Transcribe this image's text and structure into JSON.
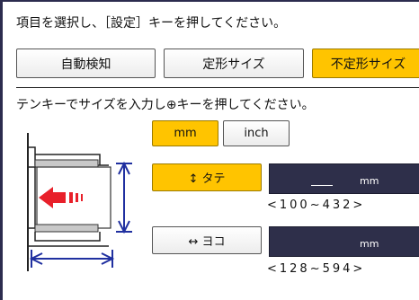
{
  "instruction": "項目を選択し、［設定］キーを押してください。",
  "tabs": [
    {
      "label": "自動検知",
      "active": false
    },
    {
      "label": "定形サイズ",
      "active": false
    },
    {
      "label": "不定形サイズ",
      "active": true
    }
  ],
  "instruction2": "テンキーでサイズを入力し⊕キーを押してください。",
  "units": {
    "mm_label": "mm",
    "inch_label": "inch",
    "selected": "mm"
  },
  "vertical": {
    "label": "↕ タテ",
    "value": "",
    "unit": "mm",
    "range": "<100~432>",
    "selected": true
  },
  "horizontal": {
    "label": "↔ ヨコ",
    "value": "",
    "unit": "mm",
    "range": "<128~594>",
    "selected": false
  },
  "colors": {
    "accent": "#ffc400",
    "field_bg": "#2e2f4a",
    "arrow_red": "#e8202a",
    "dimension_blue": "#2030a0"
  }
}
